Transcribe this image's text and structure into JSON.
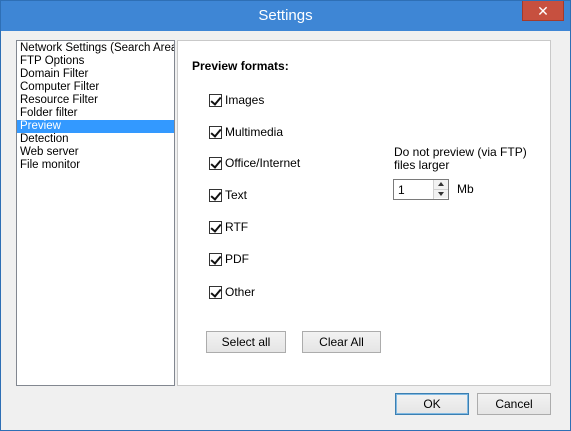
{
  "window": {
    "title": "Settings",
    "close_symbol": "✕"
  },
  "sidebar": {
    "items": [
      {
        "label": "Network Settings (Search Area",
        "selected": false
      },
      {
        "label": "FTP Options",
        "selected": false
      },
      {
        "label": "Domain Filter",
        "selected": false
      },
      {
        "label": "Computer Filter",
        "selected": false
      },
      {
        "label": "Resource Filter",
        "selected": false
      },
      {
        "label": "Folder filter",
        "selected": false
      },
      {
        "label": "Preview",
        "selected": true
      },
      {
        "label": "Detection",
        "selected": false
      },
      {
        "label": "Web server",
        "selected": false
      },
      {
        "label": "File monitor",
        "selected": false
      }
    ]
  },
  "preview": {
    "title": "Preview formats:",
    "formats": [
      {
        "label": "Images",
        "checked": true
      },
      {
        "label": "Multimedia",
        "checked": true
      },
      {
        "label": "Office/Internet",
        "checked": true
      },
      {
        "label": "Text",
        "checked": true
      },
      {
        "label": "RTF",
        "checked": true
      },
      {
        "label": "PDF",
        "checked": true
      },
      {
        "label": "Other",
        "checked": true
      }
    ],
    "ftp_note": "Do not preview (via FTP) files larger",
    "ftp_limit_value": "1",
    "ftp_limit_unit": "Mb",
    "select_all_label": "Select all",
    "clear_all_label": "Clear All"
  },
  "footer": {
    "ok_label": "OK",
    "cancel_label": "Cancel"
  },
  "colors": {
    "titlebar": "#3e86d5",
    "close_button": "#c7503f",
    "selection": "#3399ff"
  }
}
